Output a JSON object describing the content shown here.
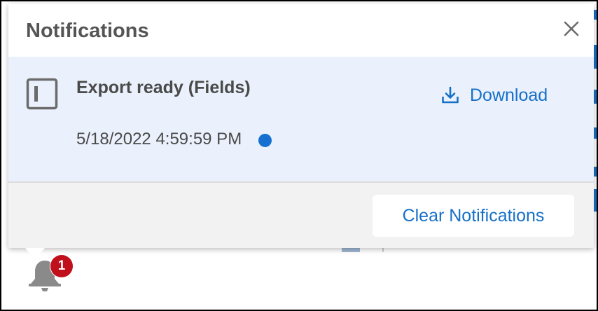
{
  "popover": {
    "title": "Notifications",
    "close_icon": "close-icon"
  },
  "notifications": [
    {
      "icon": "panel-icon",
      "title": "Export ready (Fields)",
      "timestamp": "5/18/2022 4:59:59 PM",
      "unread": true,
      "action_icon": "download-icon",
      "action_label": "Download"
    }
  ],
  "footer": {
    "clear_label": "Clear Notifications"
  },
  "bell": {
    "icon": "bell-icon",
    "badge_count": "1"
  },
  "colors": {
    "accent": "#1670c8",
    "unread_dot": "#1670d0",
    "notification_bg": "#eaf1fc",
    "badge": "#c0101c",
    "title_text": "#555555"
  }
}
